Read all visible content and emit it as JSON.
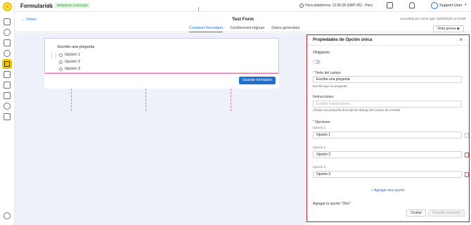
{
  "app": {
    "title": "Formularios",
    "webhook_badge": "Webphone conectado"
  },
  "topbar": {
    "clock_text": "Hora plataforma: 12:50:28 (GMT-05) - Perú",
    "user_name": "Support User"
  },
  "subheader": {
    "back_label": "Volver",
    "form_title": "Test Form",
    "saved_text": "Guardado por Ltime ago: 16/05/2025 12:44:08",
    "preview_label": "Vista previa",
    "tabs": [
      {
        "label": "Construir formulario",
        "active": true
      },
      {
        "label": "Condiciones lógicas",
        "active": false
      },
      {
        "label": "Datos generales",
        "active": false
      }
    ]
  },
  "builder": {
    "question_title": "Escribe una pregunta",
    "options": [
      "Opción 1",
      "Opción 2",
      "Opción 3"
    ],
    "save_form_label": "Guardar formulario"
  },
  "panel": {
    "title": "Propiedades de Opción única",
    "required_label": "Obligatorio",
    "field_text_label": "Texto del campo",
    "field_text_value": "Escribe una pregunta",
    "field_text_help": "Escribí aquí su pregunta",
    "instructions_label": "Instrucciones",
    "instructions_placeholder": "Escribir instrucciones",
    "instructions_help": "Añada una pequeña descripción debajo del campo de entrada",
    "options_label": "Opciones",
    "options": [
      {
        "caption": "Opción 1",
        "value": "Opción 1"
      },
      {
        "caption": "Opción 2",
        "value": "Opción 2"
      },
      {
        "caption": "Opción 3",
        "value": "Opción 3"
      }
    ],
    "add_option_label": "+ Agregar otra opción",
    "other_option_label": "Agregar la opción \"Otro\"",
    "hide_label": "Ocultar",
    "save_element_label": "Guardar elemento"
  },
  "colors": {
    "accent": "#1f6fd1",
    "brand": "#f4c400",
    "panel_border": "#b32222",
    "guide": "#e27aa6"
  }
}
